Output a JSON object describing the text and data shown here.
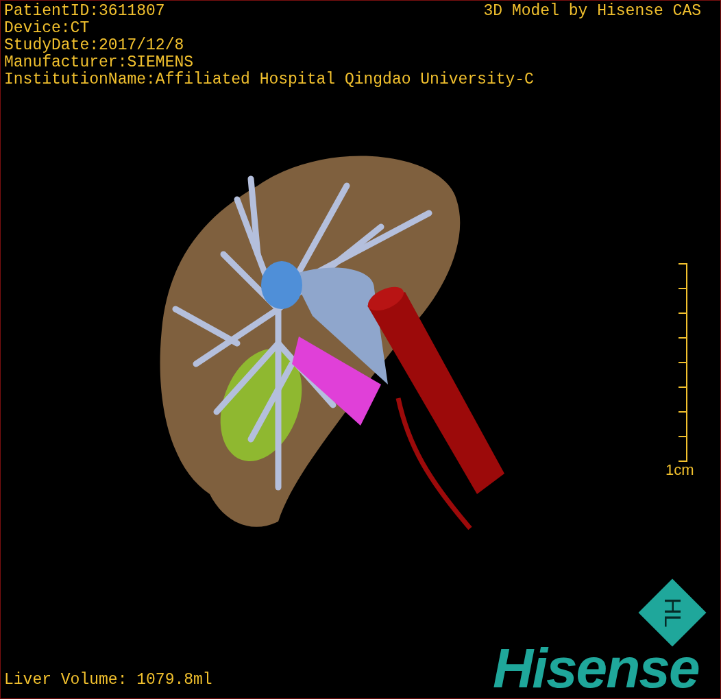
{
  "patient_info": [
    "PatientID:3611807",
    "Device:CT",
    "StudyDate:2017/12/8",
    "Manufacturer:SIEMENS",
    "InstitutionName:Affiliated Hospital Qingdao University-C"
  ],
  "model_credit": "3D Model by Hisense CAS",
  "scale_bar": {
    "label": "1cm"
  },
  "liver_volume": "Liver Volume: 1079.8ml",
  "logo": {
    "mark": "HL",
    "wordmark": "Hisense"
  }
}
